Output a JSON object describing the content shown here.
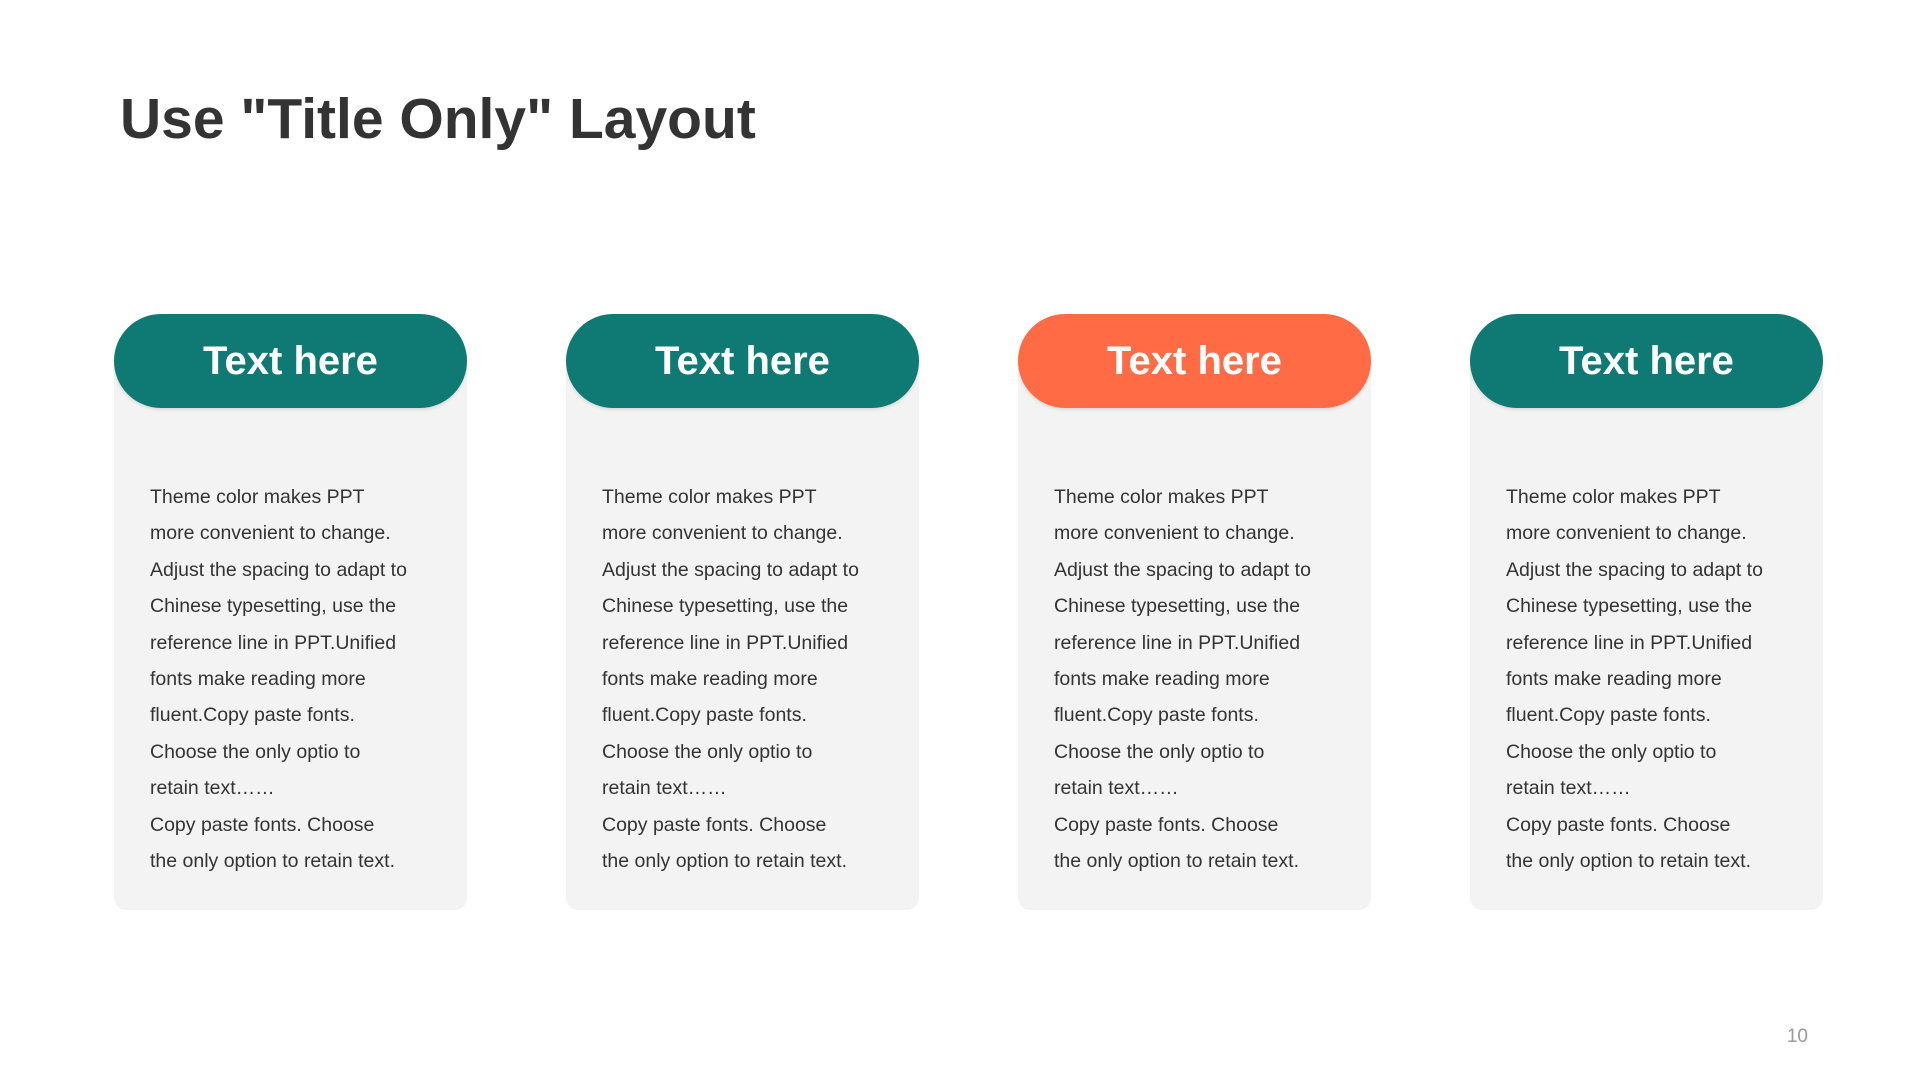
{
  "slide": {
    "title": "Use \"Title Only\" Layout",
    "page_number": "10"
  },
  "cards": [
    {
      "heading": "Text here",
      "color": "#0e7a73",
      "body": "Theme  color makes PPT\nmore convenient  to change.\nAdjust the spacing to adapt to\nChinese  typesetting, use the\nreference line in PPT.Unified\nfonts make reading more\nfluent.Copy paste fonts.\nChoose the only optio to\nretain text……\nCopy paste  fonts. Choose\nthe only option to retain text."
    },
    {
      "heading": "Text here",
      "color": "#0e7a73",
      "body": "Theme  color makes PPT\nmore convenient  to change.\nAdjust the spacing to adapt to\nChinese  typesetting, use the\nreference line in PPT.Unified\nfonts make reading more\nfluent.Copy paste fonts.\nChoose the only optio to\nretain text……\nCopy paste  fonts. Choose\nthe only option to retain text."
    },
    {
      "heading": "Text here",
      "color": "#ff6b45",
      "body": "Theme  color makes PPT\nmore convenient  to change.\nAdjust the spacing to adapt to\nChinese  typesetting, use the\nreference line in PPT.Unified\nfonts make reading more\nfluent.Copy paste fonts.\nChoose the only optio to\nretain text……\nCopy paste  fonts. Choose\nthe only option to retain text."
    },
    {
      "heading": "Text here",
      "color": "#0e7a73",
      "body": "Theme  color makes PPT\nmore convenient  to change.\nAdjust the spacing to adapt to\nChinese  typesetting, use the\nreference line in PPT.Unified\nfonts make reading more\nfluent.Copy paste fonts.\nChoose the only optio to\nretain text……\nCopy paste  fonts. Choose\nthe only option to retain text."
    }
  ]
}
